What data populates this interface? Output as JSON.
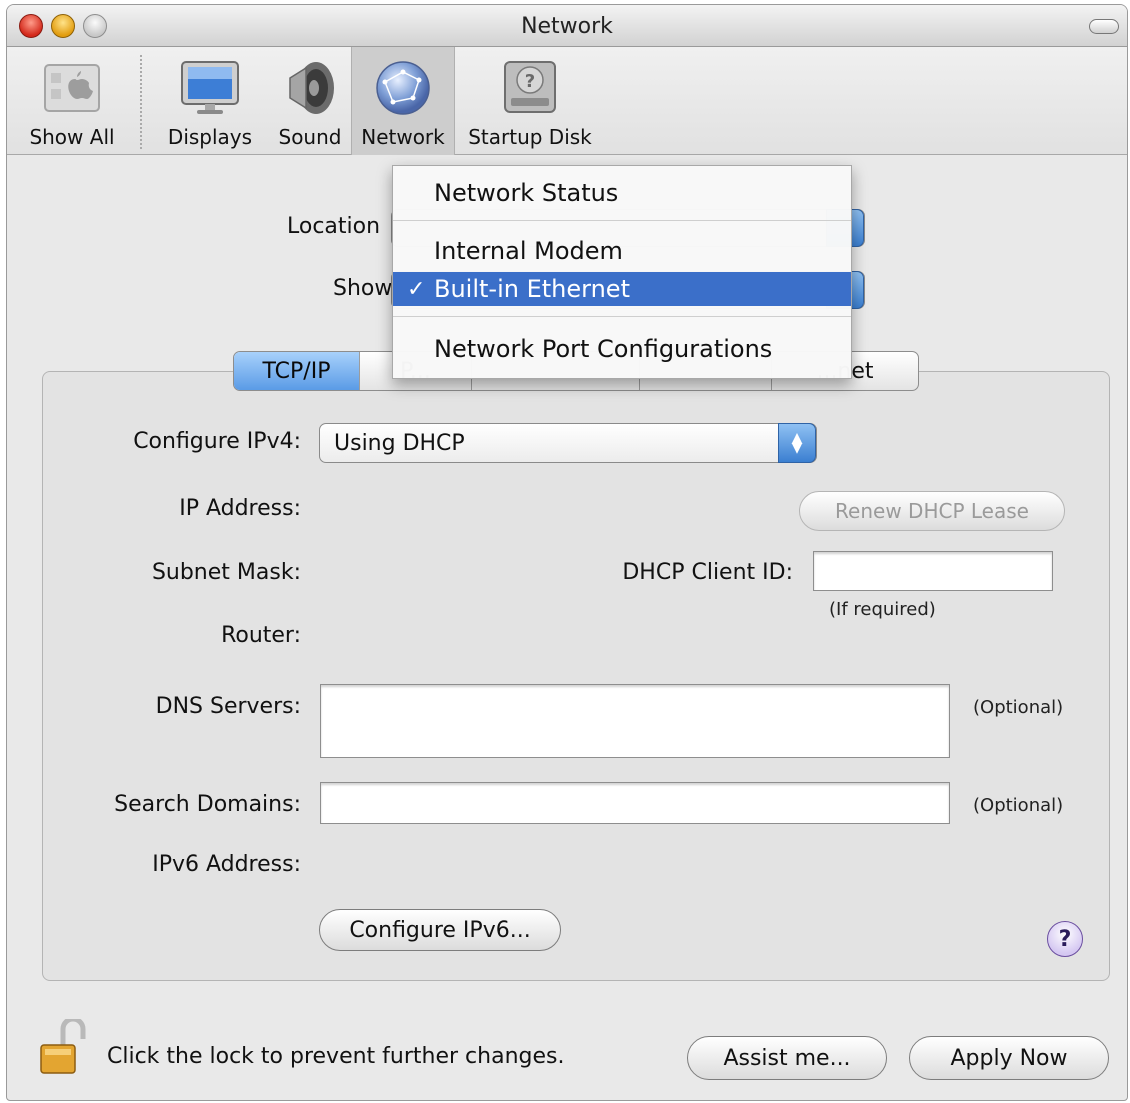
{
  "window": {
    "title": "Network"
  },
  "toolbar": {
    "items": [
      {
        "label": "Show All",
        "icon": "show-all-icon"
      },
      {
        "label": "Displays",
        "icon": "display-icon"
      },
      {
        "label": "Sound",
        "icon": "speaker-icon"
      },
      {
        "label": "Network",
        "icon": "network-globe-icon",
        "selected": true
      },
      {
        "label": "Startup Disk",
        "icon": "hard-disk-icon"
      }
    ]
  },
  "location": {
    "label": "Location"
  },
  "show": {
    "label": "Show"
  },
  "dropdown": {
    "items": [
      {
        "label": "Network Status"
      },
      {
        "label": "Internal Modem"
      },
      {
        "label": "Built-in Ethernet",
        "checked": true,
        "check": "✓"
      },
      {
        "label": "Network Port Configurations"
      }
    ]
  },
  "tabs": [
    {
      "label": "TCP/IP",
      "active": true
    },
    {
      "label": "P..."
    },
    {
      "label": ""
    },
    {
      "label": ""
    },
    {
      "label": "...net"
    }
  ],
  "tcpip": {
    "configure_ipv4_label": "Configure IPv4:",
    "configure_ipv4_value": "Using DHCP",
    "ip_address_label": "IP Address:",
    "renew_button": "Renew DHCP Lease",
    "subnet_mask_label": "Subnet Mask:",
    "dhcp_client_id_label": "DHCP Client ID:",
    "if_required": "(If required)",
    "router_label": "Router:",
    "dns_servers_label": "DNS Servers:",
    "optional": "(Optional)",
    "search_domains_label": "Search Domains:",
    "ipv6_address_label": "IPv6 Address:",
    "configure_ipv6_button": "Configure IPv6..."
  },
  "help": {
    "symbol": "?"
  },
  "footer": {
    "lock_text": "Click the lock to prevent further changes.",
    "assist_button": "Assist me...",
    "apply_button": "Apply Now"
  },
  "colors": {
    "selection": "#3b6fc9",
    "tab_active": "#5a9be6",
    "popup_accent": "#3b7fd1"
  }
}
